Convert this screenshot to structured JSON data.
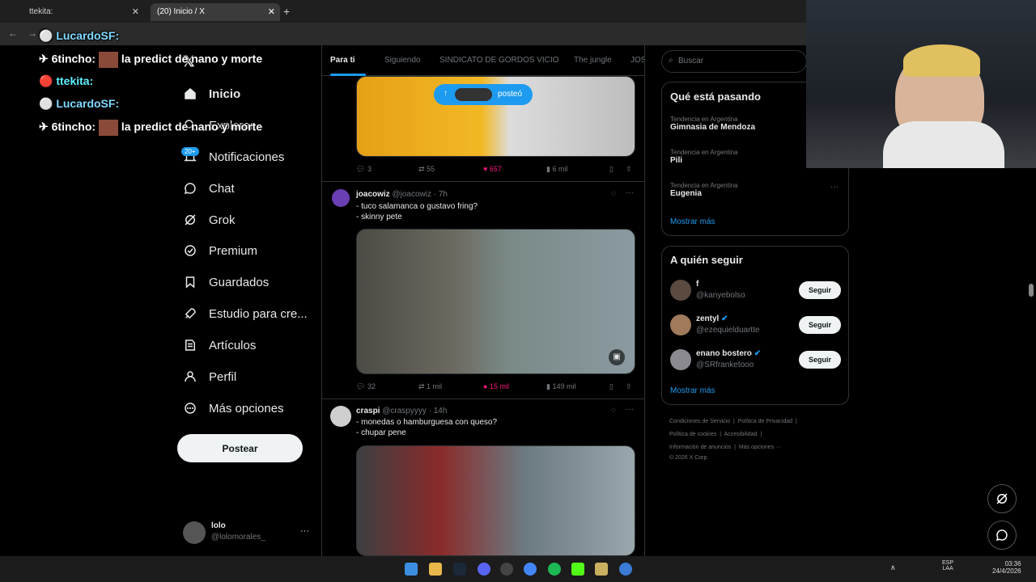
{
  "browser": {
    "tabs": [
      {
        "label": "ttekita:"
      },
      {
        "label": "(20) Inicio / X"
      }
    ],
    "new_tab": "+"
  },
  "nav": {
    "items": [
      {
        "label": "Inicio",
        "icon": "home-icon"
      },
      {
        "label": "Explorar",
        "icon": "search-icon"
      },
      {
        "label": "Notificaciones",
        "icon": "bell-icon"
      },
      {
        "label": "Chat",
        "icon": "chat-icon"
      },
      {
        "label": "Grok",
        "icon": "grok-icon"
      },
      {
        "label": "Premium",
        "icon": "premium-icon"
      },
      {
        "label": "Guardados",
        "icon": "bookmark-icon"
      },
      {
        "label": "Estudio para cre...",
        "icon": "rocket-icon"
      },
      {
        "label": "Artículos",
        "icon": "article-icon"
      },
      {
        "label": "Perfil",
        "icon": "person-icon"
      },
      {
        "label": "Más opciones",
        "icon": "more-icon"
      }
    ],
    "notifications_badge": "20+",
    "post_button": "Postear",
    "user": {
      "name": "lolo",
      "handle": "@lolomorales_",
      "more": "···"
    }
  },
  "timeline": {
    "tabs": [
      "Para ti",
      "Siguiendo",
      "SINDICATO DE GORDOS VICIO",
      "The jungle",
      "JOS"
    ],
    "posted_pill": "posteó",
    "post0_actions": {
      "replies": "3",
      "reposts": "55",
      "likes": "657",
      "views": "6 mil"
    },
    "posts": [
      {
        "name": "joacowiz",
        "handle": "@joacowiz",
        "time": "· 7h",
        "lines": [
          "- tuco salamanca o gustavo fring?",
          "- skinny pete"
        ],
        "actions": {
          "replies": "32",
          "reposts": "1 mil",
          "likes": "15 mil",
          "views": "149 mil"
        }
      },
      {
        "name": "craspi",
        "handle": "@craspyyyy",
        "time": "· 14h",
        "lines": [
          "- monedas o hamburguesa con queso?",
          "- chupar pene"
        ]
      }
    ]
  },
  "right": {
    "search_placeholder": "Buscar",
    "trends_title": "Qué está pasando",
    "trends": [
      {
        "context": "Tendencia en Argentina",
        "name": "Gimnasia de Mendoza"
      },
      {
        "context": "Tendencia en Argentina",
        "name": "Pili"
      },
      {
        "context": "Tendencia en Argentina",
        "name": "Eugenia"
      }
    ],
    "show_more": "Mostrar más",
    "who_title": "A quién seguir",
    "follow": [
      {
        "name": "f",
        "handle": "@kanyebolso"
      },
      {
        "name": "zentyl",
        "handle": "@ezequielduartte"
      },
      {
        "name": "enano bostero",
        "handle": "@SRfranketooo"
      }
    ],
    "follow_label": "Seguir",
    "show_more2": "Mostrar más",
    "footer": [
      "Condiciones de Servicio",
      "Política de Privacidad",
      "Política de cookies",
      "Accesibilidad",
      "Información de anuncios",
      "Más opciones ···",
      "© 2026 X Corp."
    ]
  },
  "chat_overlay": [
    {
      "nick": "LucardoSF:",
      "msg": ""
    },
    {
      "nick": "6tincho:",
      "msg": "la predict de nano y morte"
    },
    {
      "nick": "ttekita:",
      "msg": ""
    },
    {
      "nick": "LucardoSF:",
      "msg": ""
    },
    {
      "nick": "6tincho:",
      "msg": "la predict de nano y morte"
    }
  ],
  "taskbar": {
    "lang": "ESP",
    "lang2": "LAA",
    "time": "03:36",
    "date": "24/4/2026"
  },
  "colors": {
    "accent": "#1d9bf0",
    "like": "#f91880",
    "bg": "#000000"
  }
}
